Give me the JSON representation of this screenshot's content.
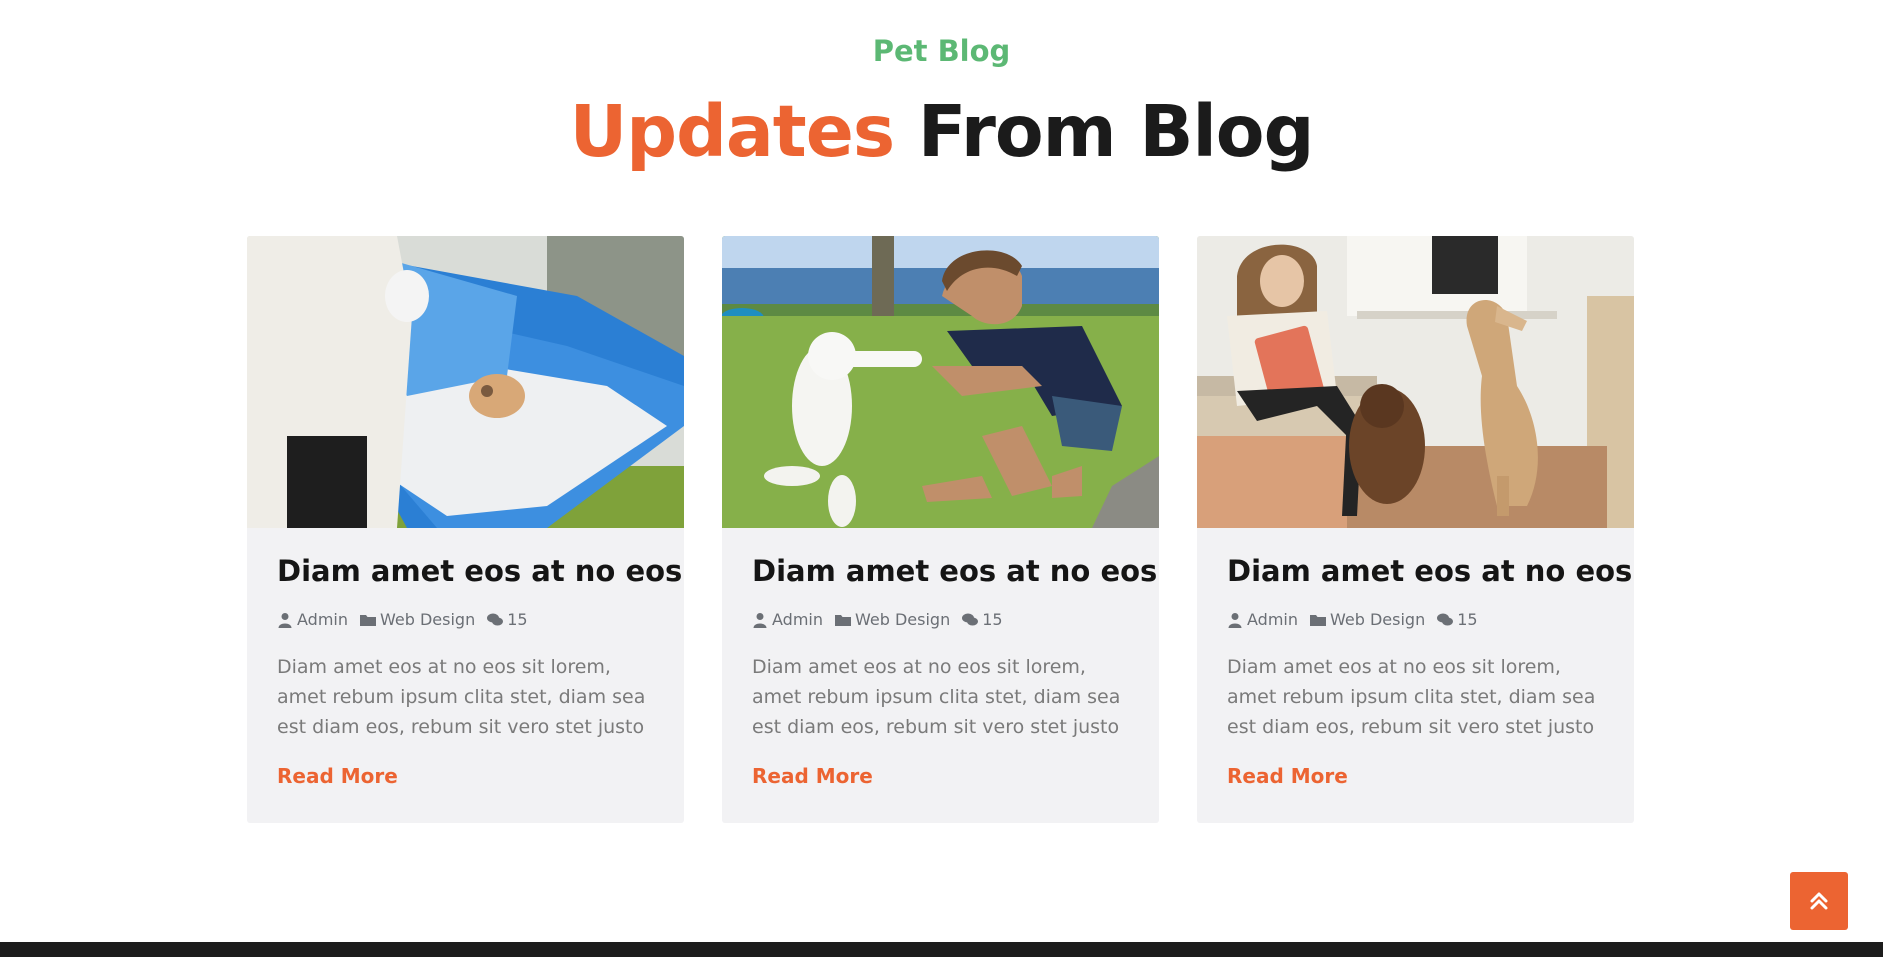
{
  "section": {
    "subtitle": "Pet Blog",
    "title_accent": "Updates",
    "title_rest": "From Blog"
  },
  "colors": {
    "accent": "#ec6432",
    "green": "#5cb874",
    "card_bg": "#f2f2f4",
    "dark": "#1b1b1b"
  },
  "posts": [
    {
      "image": "vet-cat-surgery-photo",
      "title": "Diam amet eos at no eos",
      "author": "Admin",
      "category": "Web Design",
      "comments": "15",
      "excerpt": "Diam amet eos at no eos sit lorem, amet rebum ipsum clita stet, diam sea est diam eos, rebum sit vero stet justo",
      "link": "Read More"
    },
    {
      "image": "man-with-white-puppy-photo",
      "title": "Diam amet eos at no eos",
      "author": "Admin",
      "category": "Web Design",
      "comments": "15",
      "excerpt": "Diam amet eos at no eos sit lorem, amet rebum ipsum clita stet, diam sea est diam eos, rebum sit vero stet justo",
      "link": "Read More"
    },
    {
      "image": "woman-with-dogs-photo",
      "title": "Diam amet eos at no eos",
      "author": "Admin",
      "category": "Web Design",
      "comments": "15",
      "excerpt": "Diam amet eos at no eos sit lorem, amet rebum ipsum clita stet, diam sea est diam eos, rebum sit vero stet justo",
      "link": "Read More"
    }
  ],
  "icons": {
    "author": "user-icon",
    "category": "folder-icon",
    "comments": "comments-icon",
    "back_to_top": "double-chevron-up-icon"
  }
}
